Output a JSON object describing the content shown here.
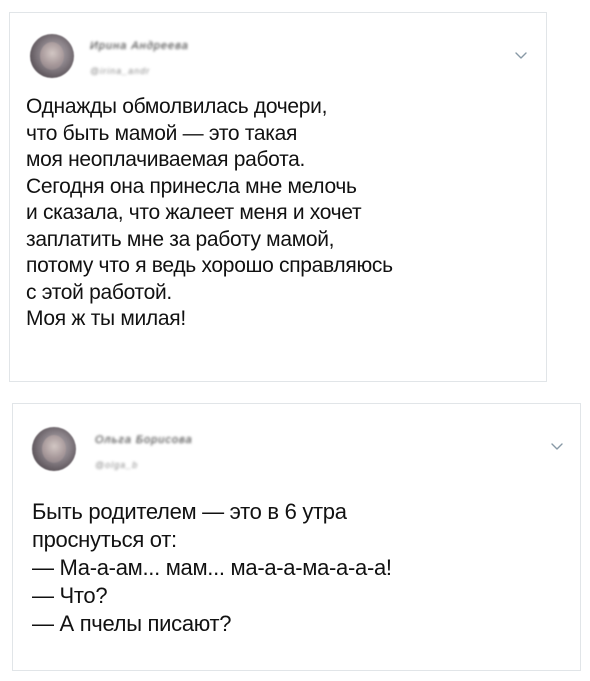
{
  "tweets": [
    {
      "author_name": "Ирина Андреева",
      "author_handle": "@irina_andr",
      "menu_icon": "chevron-down-icon",
      "text": "Однажды обмолвилась дочери,\nчто быть мамой — это такая\nмоя неоплачиваемая работа.\nСегодня она принесла мне мелочь\nи сказала, что жалеет меня и хочет\nзаплатить мне за работу мамой,\nпотому что я ведь хорошо справляюсь\nс этой работой.\nМоя ж ты милая!"
    },
    {
      "author_name": "Ольга Борисова",
      "author_handle": "@olga_b",
      "menu_icon": "chevron-down-icon",
      "text": "Быть родителем — это в 6 утра\nпроснуться от:\n— Ма-а-ам... мам... ма-а-а-ма-а-а-а!\n— Что?\n— А пчелы писают?"
    }
  ],
  "colors": {
    "card_border": "#e1e5e8",
    "text": "#111111",
    "chevron": "#8899a6"
  }
}
